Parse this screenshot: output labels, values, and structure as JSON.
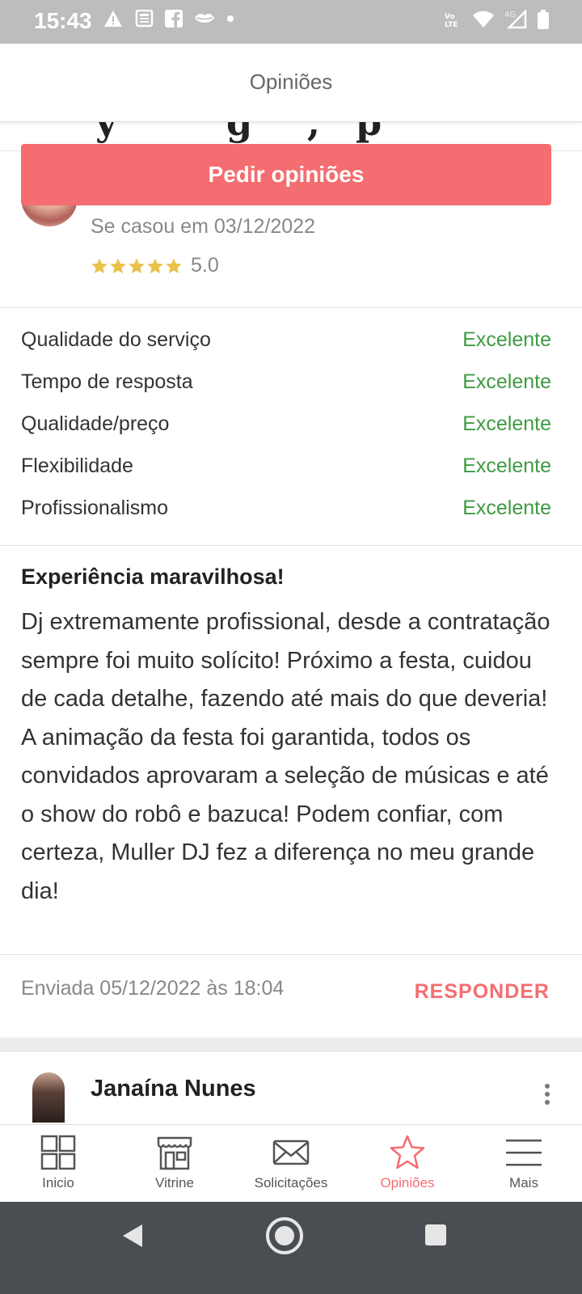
{
  "status_bar": {
    "time": "15:43",
    "network": "4G"
  },
  "header": {
    "title": "Opiniões"
  },
  "ask_button": {
    "label": "Pedir opiniões"
  },
  "review": {
    "married_date": "Se casou em 03/12/2022",
    "rating": "5.0",
    "stars": 5,
    "criteria": [
      {
        "name": "Qualidade do serviço",
        "value": "Excelente"
      },
      {
        "name": "Tempo de resposta",
        "value": "Excelente"
      },
      {
        "name": "Qualidade/preço",
        "value": "Excelente"
      },
      {
        "name": "Flexibilidade",
        "value": "Excelente"
      },
      {
        "name": "Profissionalismo",
        "value": "Excelente"
      }
    ],
    "title": "Experiência maravilhosa!",
    "body": "Dj extremamente profissional, desde a contratação sempre foi muito solícito! Próximo a festa, cuidou de cada detalhe, fazendo até mais do que deveria! A animação da festa foi garantida, todos os convidados aprovaram a seleção de músicas e até o show do robô e bazuca! Podem confiar, com certeza, Muller DJ fez a diferença no meu grande dia!",
    "sent": "Enviada 05/12/2022 às 18:04",
    "reply_label": "RESPONDER"
  },
  "next_review": {
    "name": "Janaína Nunes"
  },
  "bottom_nav": [
    {
      "label": "Inicio",
      "icon": "grid-icon"
    },
    {
      "label": "Vitrine",
      "icon": "storefront-icon"
    },
    {
      "label": "Solicitações",
      "icon": "envelope-icon"
    },
    {
      "label": "Opiniões",
      "icon": "star-icon",
      "active": true
    },
    {
      "label": "Mais",
      "icon": "menu-icon"
    }
  ],
  "colors": {
    "accent": "#f46d70",
    "positive": "#3f9a43",
    "star": "#e8c24a"
  }
}
